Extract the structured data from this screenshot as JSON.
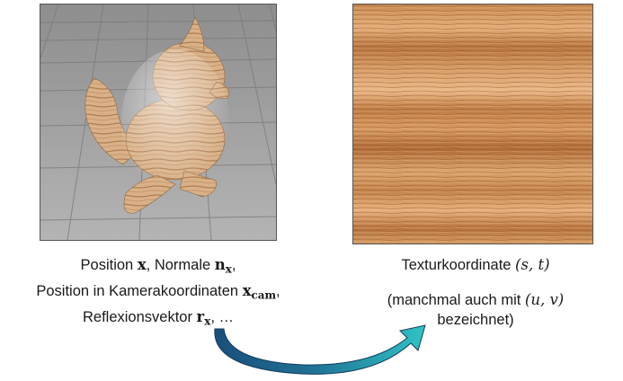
{
  "left_caption": {
    "line1_a": "Position ",
    "line1_sym": "x",
    "line1_b": ", Normale ",
    "line1_sym2": "n",
    "line1_sub2": "x",
    "line1_c": ",",
    "line2_a": "Position in Kamerakoordinaten ",
    "line2_sym": "x",
    "line2_sub": "cam",
    "line2_c": ",",
    "line3_a": "Reflexionsvektor ",
    "line3_sym": "r",
    "line3_sub": "x",
    "line3_c": ", …"
  },
  "right_caption": {
    "line1_a": "Texturkoordinate ",
    "line1_math": "(s, t)",
    "line2_a": "(manchmal auch mit ",
    "line2_math": "(u, v)",
    "line3": "bezeichnet)"
  },
  "colors": {
    "floor_bg": "#a9a9a9",
    "wood_light": "#e0b68a",
    "wood_dark": "#b8804e",
    "arrow_dark": "#1a4f7a",
    "arrow_light": "#2fc4c4"
  },
  "icons": {
    "bird_model": "wooden-bird-render",
    "wood_texture": "wood-grain-texture",
    "arrow": "curved-arrow"
  }
}
